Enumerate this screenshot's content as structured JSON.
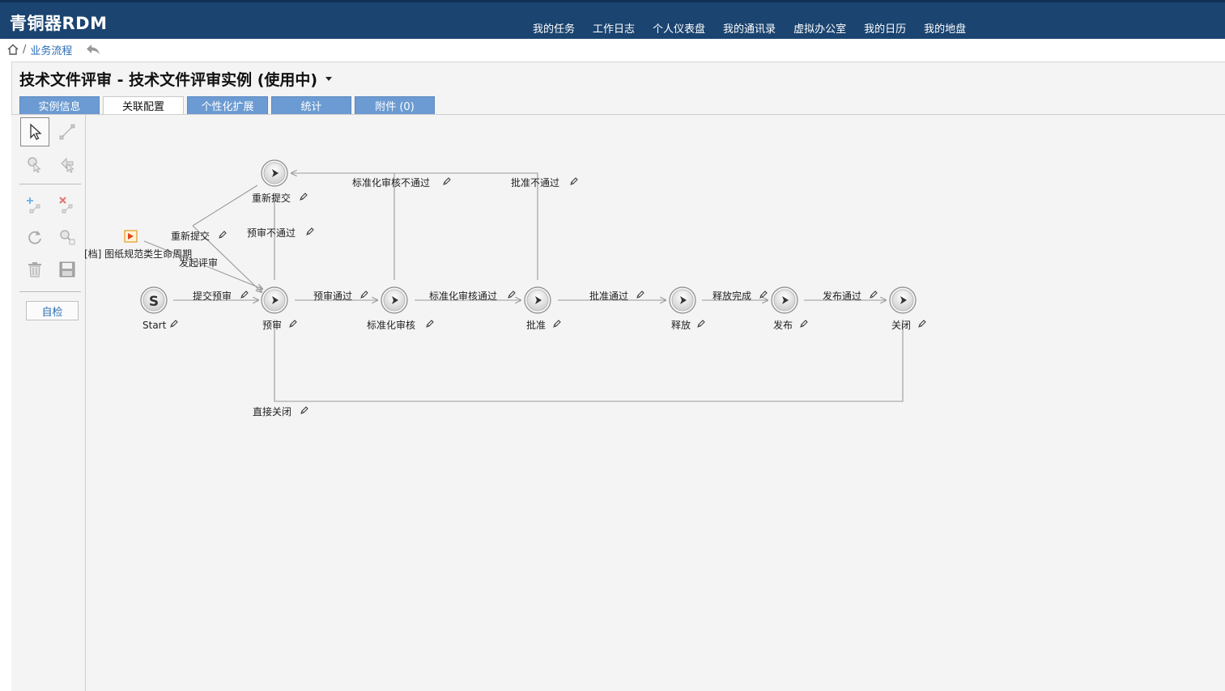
{
  "app": {
    "title": "青铜器RDM"
  },
  "topnav": [
    "我的任务",
    "工作日志",
    "个人仪表盘",
    "我的通讯录",
    "虚拟办公室",
    "我的日历",
    "我的地盘"
  ],
  "breadcrumb": {
    "link": "业务流程"
  },
  "page": {
    "title": "技术文件评审 - 技术文件评审实例 (使用中)"
  },
  "tabs": [
    {
      "label": "实例信息",
      "active": false
    },
    {
      "label": "关联配置",
      "active": true
    },
    {
      "label": "个性化扩展",
      "active": false
    },
    {
      "label": "统计",
      "active": false
    },
    {
      "label": "附件 (0)",
      "active": false
    }
  ],
  "toolbar": {
    "selfcheck_label": "自检"
  },
  "diagram": {
    "start_symbol": "S",
    "nodes": {
      "start": "Start",
      "prereview": "预审",
      "stdreview": "标准化审核",
      "approve": "批准",
      "release": "释放",
      "publish": "发布",
      "close": "关闭",
      "resubmit": "重新提交"
    },
    "edges": {
      "submit_prereview": "提交预审",
      "prereview_pass": "预审通过",
      "std_pass": "标准化审核通过",
      "approve_pass": "批准通过",
      "release_done": "释放完成",
      "publish_pass": "发布通过",
      "std_fail": "标准化审核不通过",
      "approve_fail": "批准不通过",
      "prereview_fail": "预审不通过",
      "resubmit_edge": "重新提交",
      "initiate_review": "发起评审",
      "direct_close": "直接关闭"
    },
    "external": "[档] 图纸规范类生命周期"
  },
  "colors": {
    "header": "#1b4470",
    "tab": "#6b9bd2",
    "link": "#2a6db8"
  }
}
